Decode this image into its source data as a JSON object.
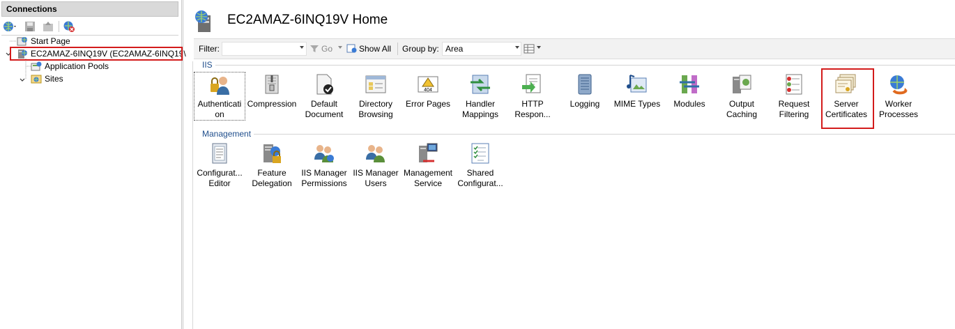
{
  "connections": {
    "title": "Connections",
    "toolbar": [
      "globe-connect-icon",
      "save-icon",
      "up-icon",
      "disconnect-icon"
    ],
    "tree": [
      {
        "label": "Start Page",
        "icon": "start-page-icon"
      },
      {
        "label": "EC2AMAZ-6INQ19V (EC2AMAZ-6INQ19\\",
        "icon": "server-icon",
        "expanded": true,
        "highlighted": true
      },
      {
        "label": "Application Pools",
        "icon": "app-pools-icon"
      },
      {
        "label": "Sites",
        "icon": "sites-icon",
        "expanded": true
      }
    ]
  },
  "header": {
    "title": "EC2AMAZ-6INQ19V Home"
  },
  "filterbar": {
    "filter_label": "Filter:",
    "filter_value": "",
    "go_label": "Go",
    "show_all_label": "Show All",
    "group_by_label": "Group by:",
    "group_by_value": "Area"
  },
  "groups": {
    "iis": {
      "label": "IIS",
      "items": [
        {
          "label": "Authenticati on",
          "icon": "authentication-icon",
          "selected": true
        },
        {
          "label": "Compression",
          "icon": "compression-icon"
        },
        {
          "label": "Default Document",
          "icon": "default-document-icon"
        },
        {
          "label": "Directory Browsing",
          "icon": "directory-browsing-icon"
        },
        {
          "label": "Error Pages",
          "icon": "error-pages-icon"
        },
        {
          "label": "Handler Mappings",
          "icon": "handler-mappings-icon"
        },
        {
          "label": "HTTP Respon...",
          "icon": "http-response-icon"
        },
        {
          "label": "Logging",
          "icon": "logging-icon"
        },
        {
          "label": "MIME Types",
          "icon": "mime-types-icon"
        },
        {
          "label": "Modules",
          "icon": "modules-icon"
        },
        {
          "label": "Output Caching",
          "icon": "output-caching-icon"
        },
        {
          "label": "Request Filtering",
          "icon": "request-filtering-icon"
        },
        {
          "label": "Server Certificates",
          "icon": "server-certificates-icon",
          "highlighted": true
        },
        {
          "label": "Worker Processes",
          "icon": "worker-processes-icon"
        }
      ]
    },
    "management": {
      "label": "Management",
      "items": [
        {
          "label": "Configurat... Editor",
          "icon": "configuration-editor-icon"
        },
        {
          "label": "Feature Delegation",
          "icon": "feature-delegation-icon"
        },
        {
          "label": "IIS Manager Permissions",
          "icon": "iis-manager-permissions-icon"
        },
        {
          "label": "IIS Manager Users",
          "icon": "iis-manager-users-icon"
        },
        {
          "label": "Management Service",
          "icon": "management-service-icon"
        },
        {
          "label": "Shared Configurat...",
          "icon": "shared-configuration-icon"
        }
      ]
    }
  },
  "colors": {
    "highlight": "#d31b1b",
    "group_label": "#1f4e8c"
  }
}
